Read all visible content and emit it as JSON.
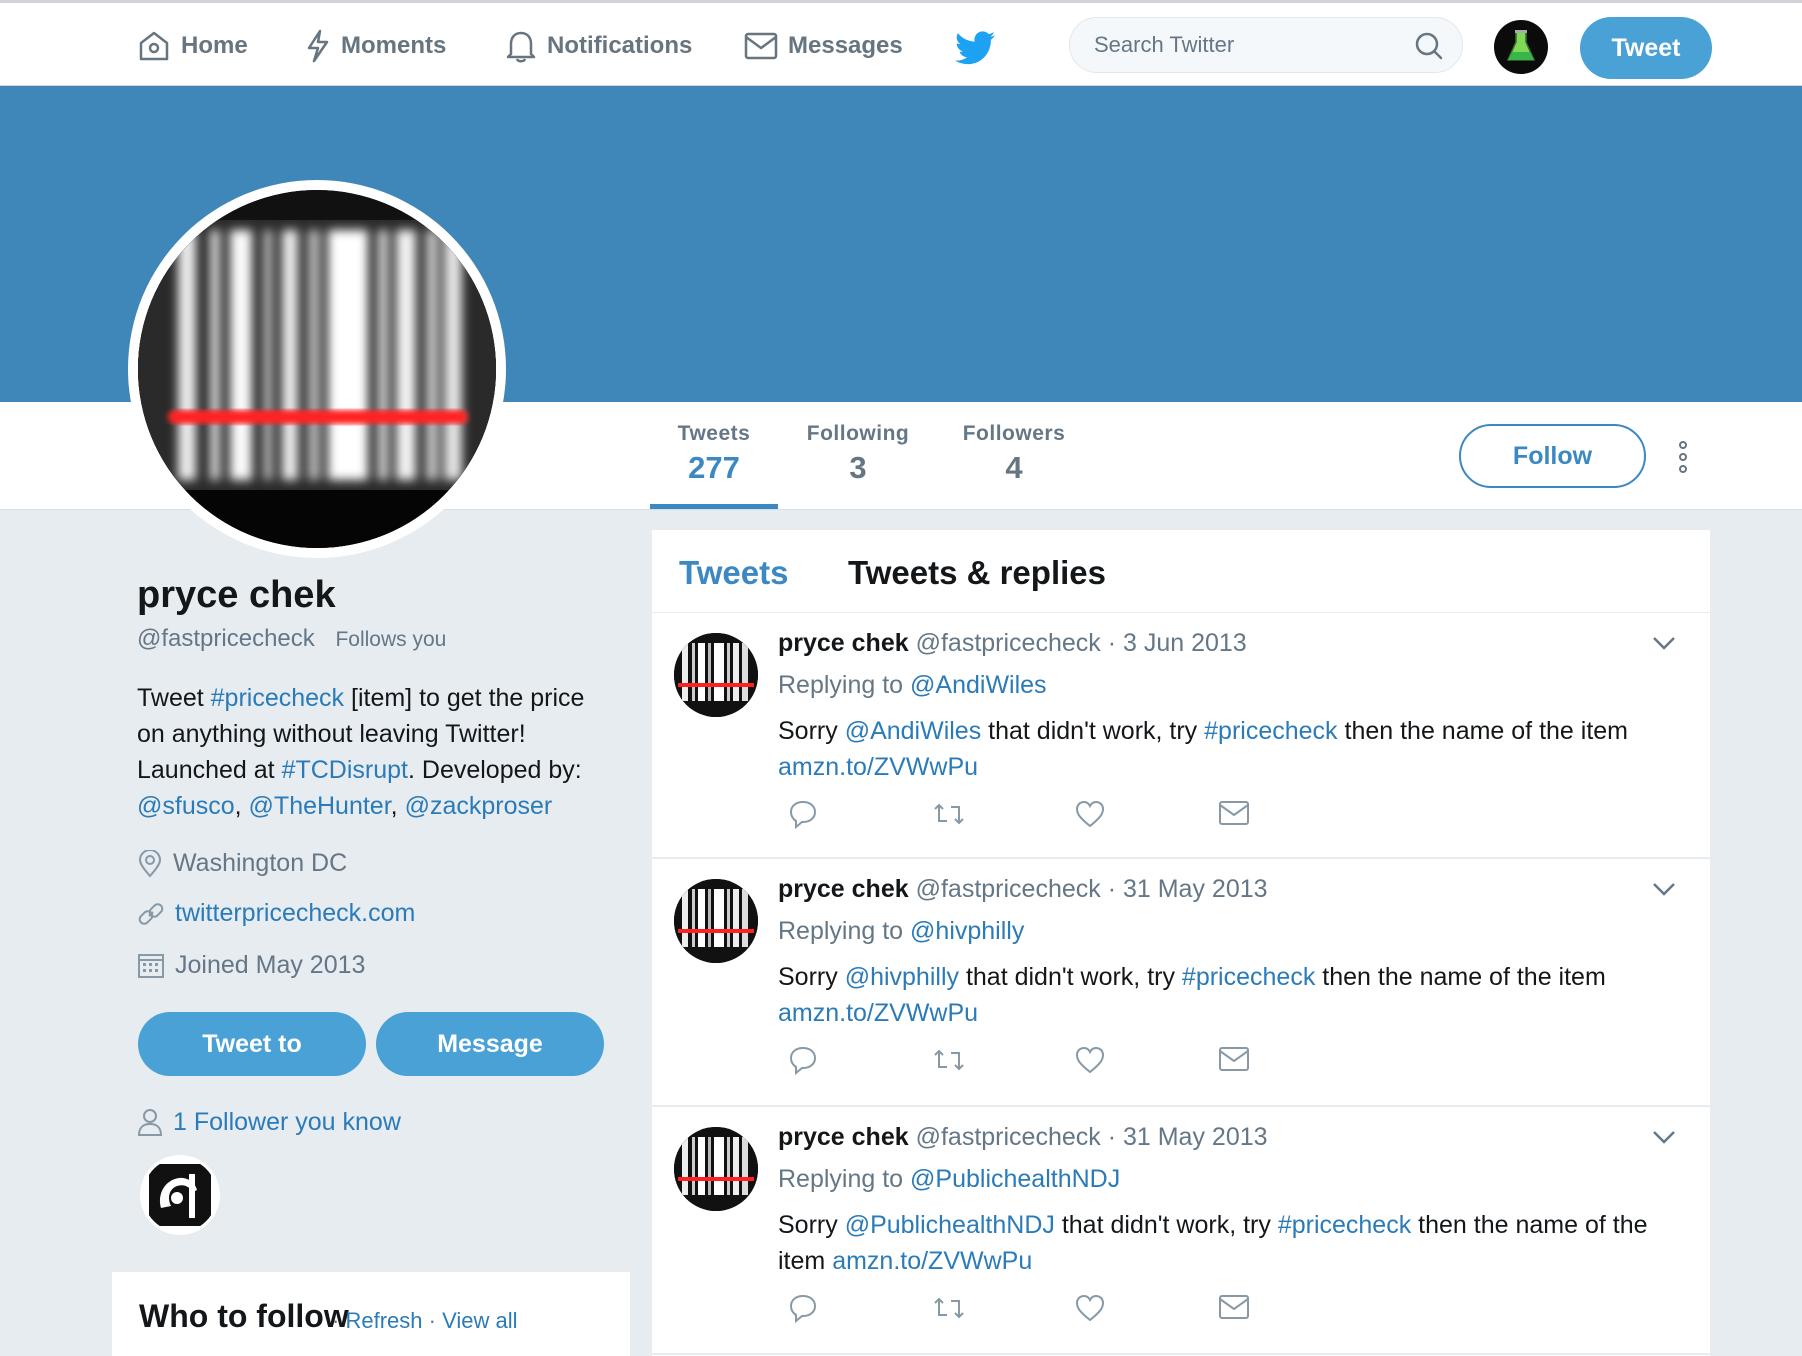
{
  "nav": {
    "home": "Home",
    "moments": "Moments",
    "notifications": "Notifications",
    "messages": "Messages",
    "search_placeholder": "Search Twitter",
    "tweet_button": "Tweet"
  },
  "profile_nav": {
    "stats": [
      {
        "label": "Tweets",
        "value": "277"
      },
      {
        "label": "Following",
        "value": "3"
      },
      {
        "label": "Followers",
        "value": "4"
      }
    ],
    "follow_button": "Follow"
  },
  "profile": {
    "name": "pryce chek",
    "handle": "@fastpricecheck",
    "follows_you": "Follows you",
    "bio": {
      "p1": "Tweet ",
      "tag1": "#pricecheck",
      "p2": " [item] to get the price on anything without leaving Twitter! Launched at ",
      "tag2": "#TCDisrupt",
      "p3": ". Developed by: ",
      "m1": "@sfusco",
      "sep1": ", ",
      "m2": "@TheHunter",
      "sep2": ", ",
      "m3": "@zackproser"
    },
    "location": "Washington DC",
    "website": "twitterpricecheck.com",
    "joined": "Joined May 2013",
    "tweet_to_button": "Tweet to",
    "message_button": "Message",
    "followers_you_know": "1 Follower you know"
  },
  "who_to_follow": {
    "title": "Who to follow",
    "dot1": " · ",
    "refresh": "Refresh",
    "dot2": " · ",
    "view_all": "View all"
  },
  "timeline": {
    "tabs": [
      "Tweets",
      "Tweets & replies"
    ],
    "tweets": [
      {
        "name": "pryce chek",
        "handle": "@fastpricecheck",
        "date": " · 3 Jun 2013",
        "replying_prefix": "Replying to ",
        "replying_to": "@AndiWiles",
        "t1": "Sorry ",
        "mention": "@AndiWiles",
        "t2": " that didn't work, try ",
        "hashtag": "#pricecheck",
        "t3": " then the name of the item ",
        "link": "amzn.to/ZVWwPu"
      },
      {
        "name": "pryce chek",
        "handle": "@fastpricecheck",
        "date": " · 31 May 2013",
        "replying_prefix": "Replying to ",
        "replying_to": "@hivphilly",
        "t1": "Sorry ",
        "mention": "@hivphilly",
        "t2": " that didn't work, try ",
        "hashtag": "#pricecheck",
        "t3": " then the name of the item ",
        "link": "amzn.to/ZVWwPu"
      },
      {
        "name": "pryce chek",
        "handle": "@fastpricecheck",
        "date": " · 31 May 2013",
        "replying_prefix": "Replying to ",
        "replying_to": "@PublichealthNDJ",
        "t1": "Sorry ",
        "mention": "@PublichealthNDJ",
        "t2": " that didn't work, try ",
        "hashtag": "#pricecheck",
        "t3": " then the name of the item ",
        "link": "amzn.to/ZVWwPu"
      }
    ]
  },
  "colors": {
    "brand_blue": "#3b88c3",
    "banner": "#3f86b9",
    "button_blue": "#4aa1d6",
    "background": "#e6ecf0"
  }
}
